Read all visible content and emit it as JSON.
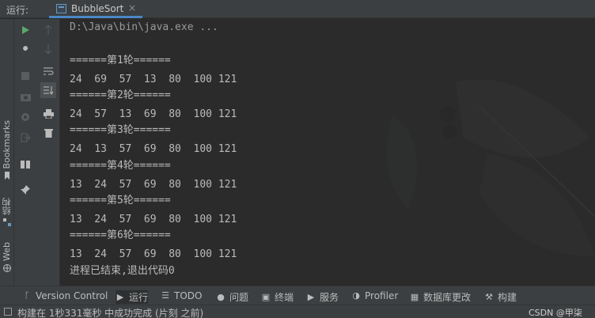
{
  "header": {
    "run_label": "运行:",
    "tab_title": "BubbleSort",
    "tab_close": "×"
  },
  "side_tabs": {
    "bookmarks": "Bookmarks",
    "structure": "结构",
    "web": "Web"
  },
  "console": {
    "command": "D:\\Java\\bin\\java.exe ...",
    "lines": [
      "======第1轮======",
      "24  69  57  13  80  100 121",
      "======第2轮======",
      "24  57  13  69  80  100 121",
      "======第3轮======",
      "24  13  57  69  80  100 121",
      "======第4轮======",
      "13  24  57  69  80  100 121",
      "======第5轮======",
      "13  24  57  69  80  100 121",
      "======第6轮======",
      "13  24  57  69  80  100 121"
    ],
    "exit_message": "进程已结束,退出代码0"
  },
  "bottom_tabs": [
    {
      "label": "Version Control",
      "icon": "branch-icon"
    },
    {
      "label": "运行",
      "icon": "run-icon"
    },
    {
      "label": "TODO",
      "icon": "list-icon"
    },
    {
      "label": "问题",
      "icon": "problems-icon"
    },
    {
      "label": "终端",
      "icon": "terminal-icon"
    },
    {
      "label": "服务",
      "icon": "services-icon"
    },
    {
      "label": "Profiler",
      "icon": "profiler-icon"
    },
    {
      "label": "数据库更改",
      "icon": "database-icon"
    },
    {
      "label": "构建",
      "icon": "build-icon"
    }
  ],
  "status": {
    "text": "构建在 1秒331毫秒 中成功完成 (片刻 之前)"
  },
  "watermark": "CSDN @甲柒",
  "colors": {
    "accent": "#4a88c7",
    "run_green": "#59a869",
    "panel": "#3c3f41",
    "console_bg": "#2b2b2b",
    "text": "#bbbbbb"
  }
}
